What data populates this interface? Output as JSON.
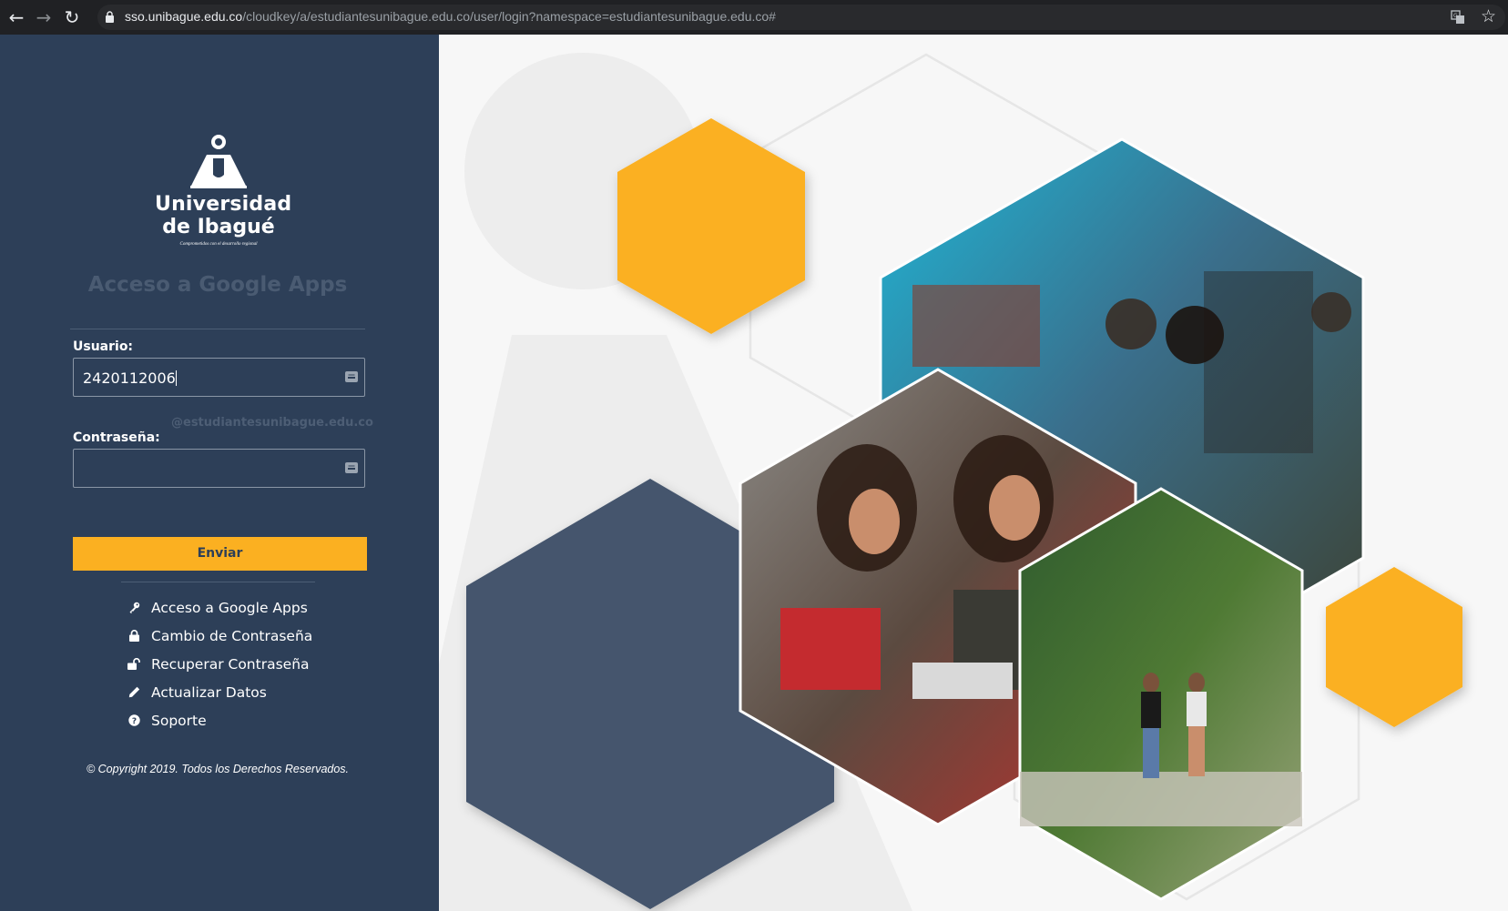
{
  "browser": {
    "url_host": "sso.unibague.edu.co",
    "url_path": "/cloudkey/a/estudiantesunibague.edu.co/user/login?namespace=estudiantesunibague.edu.co#",
    "back_icon": "arrow-left-icon",
    "forward_icon": "arrow-right-icon",
    "reload_icon": "reload-icon"
  },
  "logo": {
    "line1": "Universidad",
    "line2": "de Ibagué",
    "tagline": "Comprometidos con el desarrollo regional"
  },
  "login": {
    "title": "Acceso a Google Apps",
    "user_label": "Usuario:",
    "user_value": "2420112006",
    "domain_hint": "@estudiantesunibague.edu.co",
    "password_label": "Contraseña:",
    "password_value": "",
    "submit_label": "Enviar"
  },
  "menu": [
    {
      "label": "Acceso a Google Apps",
      "icon": "key-icon"
    },
    {
      "label": "Cambio de Contraseña",
      "icon": "lock-icon"
    },
    {
      "label": "Recuperar Contraseña",
      "icon": "unlock-icon"
    },
    {
      "label": "Actualizar Datos",
      "icon": "pencil-icon"
    },
    {
      "label": "Soporte",
      "icon": "question-circle-icon"
    }
  ],
  "footer": {
    "copyright": "© Copyright 2019. Todos los Derechos Reservados."
  },
  "colors": {
    "panel": "#2d3f58",
    "accent": "#fbb021",
    "hex_dark": "#44556d"
  }
}
